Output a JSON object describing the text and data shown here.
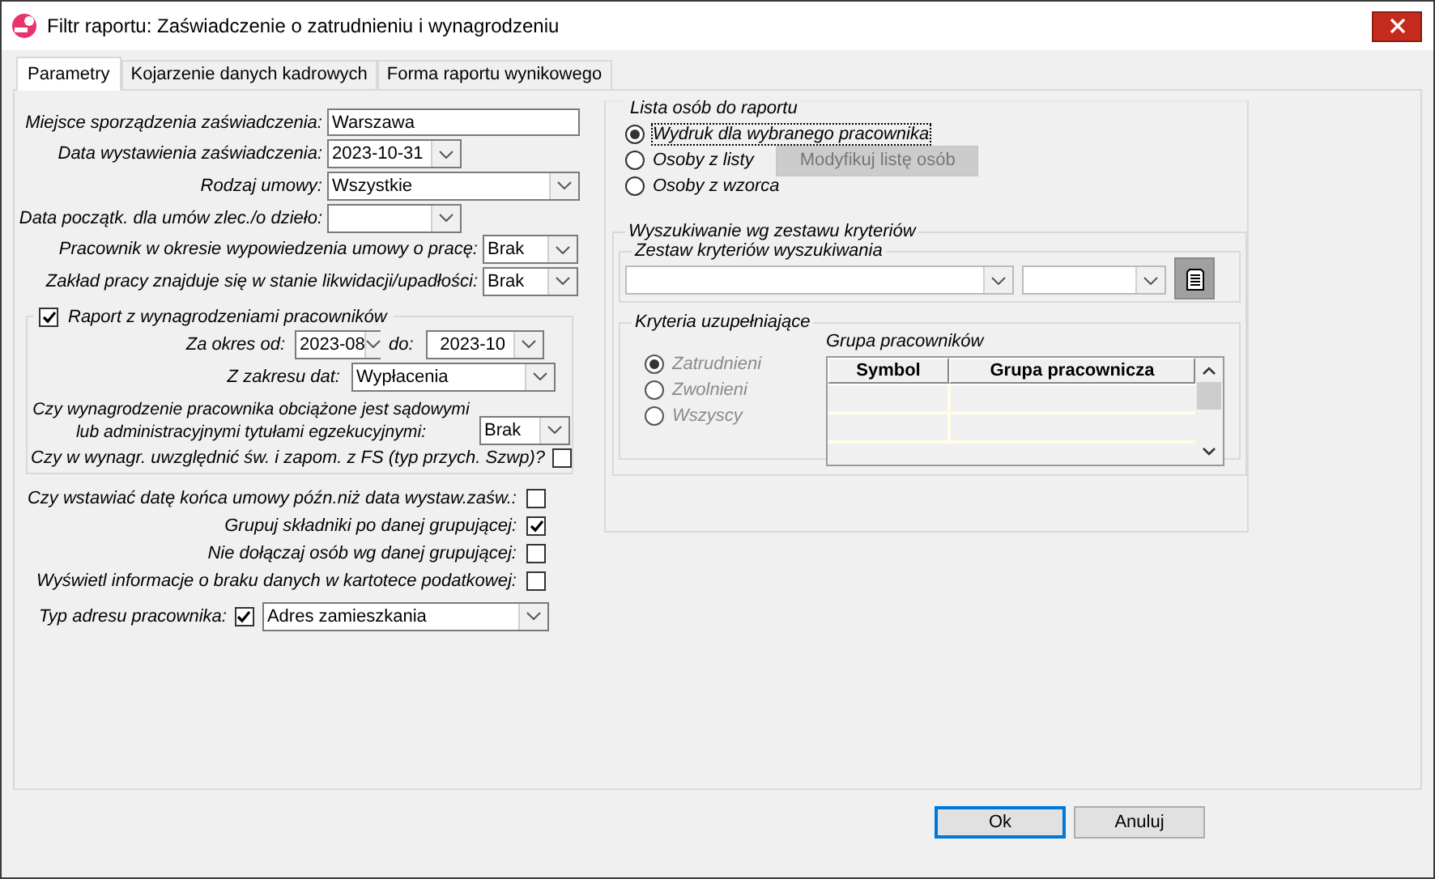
{
  "window": {
    "title": "Filtr raportu: Zaświadczenie o zatrudnieniu i wynagrodzeniu"
  },
  "tabs": [
    {
      "label": "Parametry",
      "selected": true
    },
    {
      "label": "Kojarzenie danych kadrowych",
      "selected": false
    },
    {
      "label": "Forma raportu wynikowego",
      "selected": false
    }
  ],
  "fields": [
    {
      "kind": "text",
      "label": "Miejsce sporządzenia zaświadczenia:",
      "value": "Warszawa"
    },
    {
      "kind": "combo",
      "label": "Data wystawienia zaświadczenia:",
      "value": "2023-10-31"
    },
    {
      "kind": "combo",
      "label": "Rodzaj umowy:",
      "value": "Wszystkie"
    },
    {
      "kind": "combo",
      "label": "Data początk. dla umów zlec./o dzieło:"
    },
    {
      "kind": "combo",
      "label": "Pracownik w okresie wypowiedzenia umowy o pracę:",
      "value": "Brak"
    },
    {
      "kind": "combo",
      "label": "Zakład pracy znajduje się w stanie likwidacji/upadłości:",
      "value": "Brak"
    }
  ],
  "salary_report": {
    "label": "Raport z wynagrodzeniami pracowników",
    "checked": true,
    "period_from": {
      "label": "Za okres od:",
      "value": "2023-08"
    },
    "period_to": {
      "label": "do:",
      "value": "2023-10"
    },
    "date_range": {
      "label": "Z zakresu dat:",
      "value": "Wypłacenia"
    },
    "enforcement": {
      "label_lines": [
        "Czy wynagrodzenie pracownika obciążone jest sądowymi",
        "lub administracyjnymi tytułami egzekucyjnymi:"
      ],
      "value": "Brak"
    },
    "social_fund": {
      "label": "Czy w wynagr. uwzględnić św. i zapom. z FS (typ przych. Szwp)?",
      "checked": false
    }
  },
  "options": [
    {
      "label": "Czy wstawiać datę końca umowy późn.niż data wystaw.zaśw.:",
      "checked": false
    },
    {
      "label": "Grupuj składniki po danej grupującej:",
      "checked": true
    },
    {
      "label": "Nie dołączaj osób wg danej grupującej:",
      "checked": false
    },
    {
      "label": "Wyświetl informacje o braku danych w kartotece podatkowej:",
      "checked": false
    }
  ],
  "address_type": {
    "label": "Typ adresu pracownika:",
    "checked": true,
    "value": "Adres zamieszkania"
  },
  "person_list": {
    "title": "Lista osób do raportu",
    "options": [
      {
        "label": "Wydruk dla wybranego pracownika",
        "selected": true,
        "focused": true
      },
      {
        "label": "Osoby z listy",
        "selected": false,
        "focused": false
      },
      {
        "label": "Osoby z wzorca",
        "selected": false,
        "focused": false
      }
    ],
    "modify_button": {
      "label": "Modyfikuj listę osób",
      "disabled": true
    }
  },
  "criteria_search": {
    "title": "Wyszukiwanie wg zestawu kryteriów",
    "set_title": "Zestaw kryteriów wyszukiwania",
    "supplementary": {
      "title": "Kryteria uzupełniające",
      "disabled": true,
      "options": [
        {
          "label": "Zatrudnieni",
          "selected": true
        },
        {
          "label": "Zwolnieni",
          "selected": false
        },
        {
          "label": "Wszyscy",
          "selected": false
        }
      ],
      "group_title": "Grupa pracowników",
      "columns": [
        "Symbol",
        "Grupa pracownicza"
      ]
    }
  },
  "buttons": [
    {
      "label": "Ok",
      "default": true
    },
    {
      "label": "Anuluj",
      "default": false
    }
  ]
}
